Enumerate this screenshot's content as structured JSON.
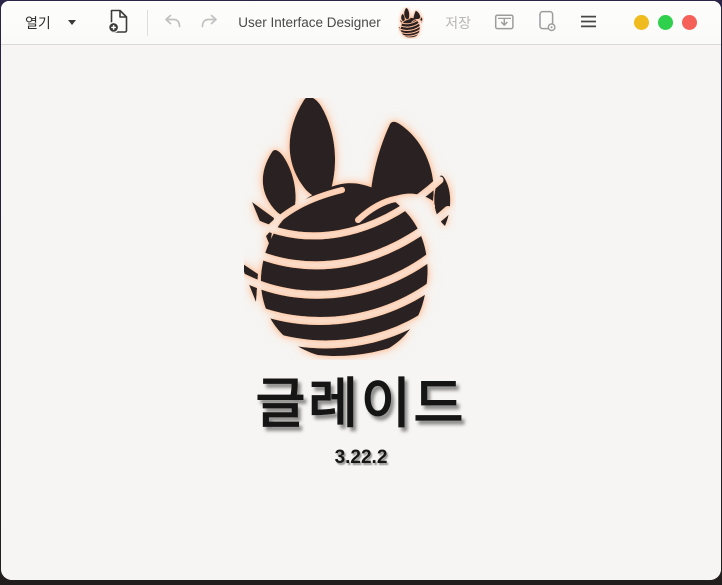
{
  "header": {
    "open_label": "열기",
    "title": "User Interface Designer",
    "save_label": "저장"
  },
  "splash": {
    "app_name": "글레이드",
    "version": "3.22.2"
  },
  "window_controls": [
    {
      "name": "minimize",
      "color": "#f0bb1f"
    },
    {
      "name": "maximize",
      "color": "#2fd04b"
    },
    {
      "name": "close",
      "color": "#f56158"
    }
  ],
  "icons": {
    "open_dropdown": "chevron-down",
    "new_project": "document-plus",
    "undo": "arrow-undo",
    "redo": "arrow-redo",
    "app_logo": "glade-flame",
    "save_as": "save-tray",
    "project_properties": "document-gear",
    "menu": "hamburger"
  },
  "colors": {
    "header_bg": "#fcfcfb",
    "content_bg": "#f6f5f3",
    "logo_black": "#2a2320",
    "logo_glow": "#ffbb93",
    "desktop_top": "#2b2547",
    "desktop_bottom": "#221d1d"
  }
}
